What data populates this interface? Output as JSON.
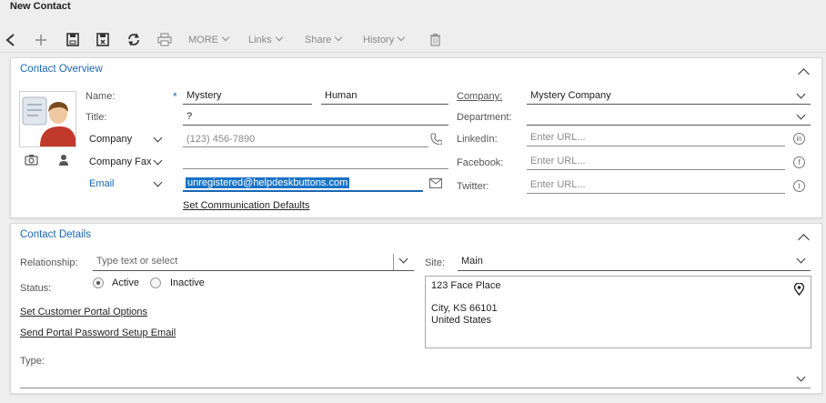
{
  "window": {
    "title": "New Contact"
  },
  "toolbar": {
    "back_icon": "back-arrow-icon",
    "add_icon": "plus-icon",
    "save_icon": "save-icon",
    "save_close_icon": "save-close-icon",
    "refresh_icon": "refresh-icon",
    "print_icon": "print-icon",
    "more": "MORE",
    "links": "Links",
    "share": "Share",
    "history": "History",
    "delete_icon": "trash-icon"
  },
  "overview": {
    "title": "Contact Overview",
    "name_label": "Name:",
    "required_mark": "*",
    "first_name": "Mystery",
    "last_name": "Human",
    "title_label": "Title:",
    "title_value": "?",
    "phone_type": "Company",
    "phone_placeholder": "(123) 456-7890",
    "fax_type": "Company Fax",
    "email_type": "Email",
    "email_value": "unregistered@helpdeskbuttons.com",
    "set_defaults": "Set Communication Defaults",
    "company_label": "Company:",
    "company_value": "Mystery Company",
    "department_label": "Department:",
    "linkedin_label": "LinkedIn:",
    "facebook_label": "Facebook:",
    "twitter_label": "Twitter:",
    "url_placeholder": "Enter URL..."
  },
  "details": {
    "title": "Contact Details",
    "relationship_label": "Relationship:",
    "relationship_placeholder": "Type text or select",
    "status_label": "Status:",
    "status_options": [
      "Active",
      "Inactive"
    ],
    "status_selected": "Active",
    "portal_options": "Set Customer Portal Options",
    "portal_email": "Send Portal Password Setup Email",
    "type_label": "Type:",
    "site_label": "Site:",
    "site_value": "Main",
    "address_line1": "123 Face Place",
    "address_line2": "City, KS 66101",
    "address_line3": "United States"
  },
  "colors": {
    "accent": "#1a66b3",
    "selection": "#1a73c8",
    "background": "#eeeeee"
  }
}
